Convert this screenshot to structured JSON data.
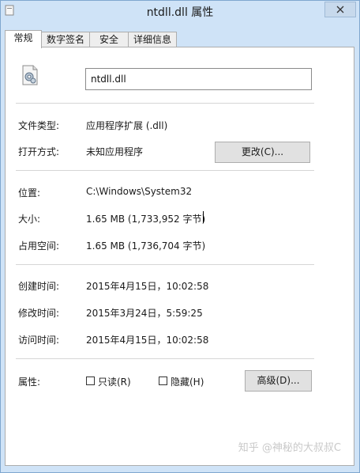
{
  "window": {
    "title": "ntdll.dll 属性"
  },
  "tabs": [
    {
      "label": "常规"
    },
    {
      "label": "数字签名"
    },
    {
      "label": "安全"
    },
    {
      "label": "详细信息"
    }
  ],
  "general": {
    "filename": "ntdll.dll",
    "file_type_label": "文件类型:",
    "file_type_value": "应用程序扩展 (.dll)",
    "open_with_label": "打开方式:",
    "open_with_value": "未知应用程序",
    "change_button": "更改(C)...",
    "location_label": "位置:",
    "location_value": "C:\\Windows\\System32",
    "size_label": "大小:",
    "size_value": "1.65 MB (1,733,952 字节)",
    "size_on_disk_label": "占用空间:",
    "size_on_disk_value": "1.65 MB (1,736,704 字节)",
    "created_label": "创建时间:",
    "created_value": "2015年4月15日，10:02:58",
    "modified_label": "修改时间:",
    "modified_value": "2015年3月24日，5:59:25",
    "accessed_label": "访问时间:",
    "accessed_value": "2015年4月15日，10:02:58",
    "attributes_label": "属性:",
    "readonly_label": "只读(R)",
    "hidden_label": "隐藏(H)",
    "advanced_button": "高级(D)..."
  },
  "watermark": "知乎 @神秘的大叔叔C"
}
